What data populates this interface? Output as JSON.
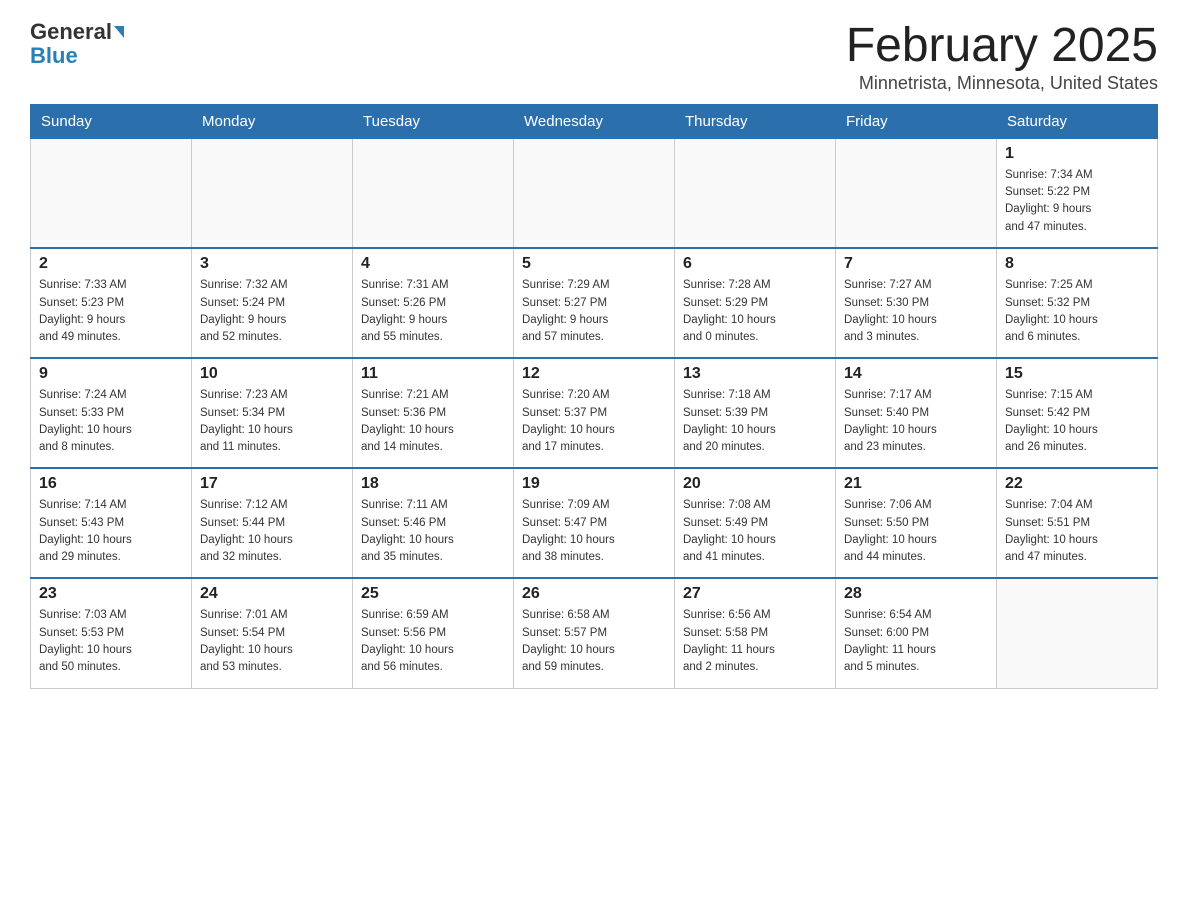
{
  "header": {
    "logo_general": "General",
    "logo_blue": "Blue",
    "month_title": "February 2025",
    "location": "Minnetrista, Minnesota, United States"
  },
  "weekdays": [
    "Sunday",
    "Monday",
    "Tuesday",
    "Wednesday",
    "Thursday",
    "Friday",
    "Saturday"
  ],
  "weeks": [
    [
      {
        "day": "",
        "info": ""
      },
      {
        "day": "",
        "info": ""
      },
      {
        "day": "",
        "info": ""
      },
      {
        "day": "",
        "info": ""
      },
      {
        "day": "",
        "info": ""
      },
      {
        "day": "",
        "info": ""
      },
      {
        "day": "1",
        "info": "Sunrise: 7:34 AM\nSunset: 5:22 PM\nDaylight: 9 hours\nand 47 minutes."
      }
    ],
    [
      {
        "day": "2",
        "info": "Sunrise: 7:33 AM\nSunset: 5:23 PM\nDaylight: 9 hours\nand 49 minutes."
      },
      {
        "day": "3",
        "info": "Sunrise: 7:32 AM\nSunset: 5:24 PM\nDaylight: 9 hours\nand 52 minutes."
      },
      {
        "day": "4",
        "info": "Sunrise: 7:31 AM\nSunset: 5:26 PM\nDaylight: 9 hours\nand 55 minutes."
      },
      {
        "day": "5",
        "info": "Sunrise: 7:29 AM\nSunset: 5:27 PM\nDaylight: 9 hours\nand 57 minutes."
      },
      {
        "day": "6",
        "info": "Sunrise: 7:28 AM\nSunset: 5:29 PM\nDaylight: 10 hours\nand 0 minutes."
      },
      {
        "day": "7",
        "info": "Sunrise: 7:27 AM\nSunset: 5:30 PM\nDaylight: 10 hours\nand 3 minutes."
      },
      {
        "day": "8",
        "info": "Sunrise: 7:25 AM\nSunset: 5:32 PM\nDaylight: 10 hours\nand 6 minutes."
      }
    ],
    [
      {
        "day": "9",
        "info": "Sunrise: 7:24 AM\nSunset: 5:33 PM\nDaylight: 10 hours\nand 8 minutes."
      },
      {
        "day": "10",
        "info": "Sunrise: 7:23 AM\nSunset: 5:34 PM\nDaylight: 10 hours\nand 11 minutes."
      },
      {
        "day": "11",
        "info": "Sunrise: 7:21 AM\nSunset: 5:36 PM\nDaylight: 10 hours\nand 14 minutes."
      },
      {
        "day": "12",
        "info": "Sunrise: 7:20 AM\nSunset: 5:37 PM\nDaylight: 10 hours\nand 17 minutes."
      },
      {
        "day": "13",
        "info": "Sunrise: 7:18 AM\nSunset: 5:39 PM\nDaylight: 10 hours\nand 20 minutes."
      },
      {
        "day": "14",
        "info": "Sunrise: 7:17 AM\nSunset: 5:40 PM\nDaylight: 10 hours\nand 23 minutes."
      },
      {
        "day": "15",
        "info": "Sunrise: 7:15 AM\nSunset: 5:42 PM\nDaylight: 10 hours\nand 26 minutes."
      }
    ],
    [
      {
        "day": "16",
        "info": "Sunrise: 7:14 AM\nSunset: 5:43 PM\nDaylight: 10 hours\nand 29 minutes."
      },
      {
        "day": "17",
        "info": "Sunrise: 7:12 AM\nSunset: 5:44 PM\nDaylight: 10 hours\nand 32 minutes."
      },
      {
        "day": "18",
        "info": "Sunrise: 7:11 AM\nSunset: 5:46 PM\nDaylight: 10 hours\nand 35 minutes."
      },
      {
        "day": "19",
        "info": "Sunrise: 7:09 AM\nSunset: 5:47 PM\nDaylight: 10 hours\nand 38 minutes."
      },
      {
        "day": "20",
        "info": "Sunrise: 7:08 AM\nSunset: 5:49 PM\nDaylight: 10 hours\nand 41 minutes."
      },
      {
        "day": "21",
        "info": "Sunrise: 7:06 AM\nSunset: 5:50 PM\nDaylight: 10 hours\nand 44 minutes."
      },
      {
        "day": "22",
        "info": "Sunrise: 7:04 AM\nSunset: 5:51 PM\nDaylight: 10 hours\nand 47 minutes."
      }
    ],
    [
      {
        "day": "23",
        "info": "Sunrise: 7:03 AM\nSunset: 5:53 PM\nDaylight: 10 hours\nand 50 minutes."
      },
      {
        "day": "24",
        "info": "Sunrise: 7:01 AM\nSunset: 5:54 PM\nDaylight: 10 hours\nand 53 minutes."
      },
      {
        "day": "25",
        "info": "Sunrise: 6:59 AM\nSunset: 5:56 PM\nDaylight: 10 hours\nand 56 minutes."
      },
      {
        "day": "26",
        "info": "Sunrise: 6:58 AM\nSunset: 5:57 PM\nDaylight: 10 hours\nand 59 minutes."
      },
      {
        "day": "27",
        "info": "Sunrise: 6:56 AM\nSunset: 5:58 PM\nDaylight: 11 hours\nand 2 minutes."
      },
      {
        "day": "28",
        "info": "Sunrise: 6:54 AM\nSunset: 6:00 PM\nDaylight: 11 hours\nand 5 minutes."
      },
      {
        "day": "",
        "info": ""
      }
    ]
  ]
}
